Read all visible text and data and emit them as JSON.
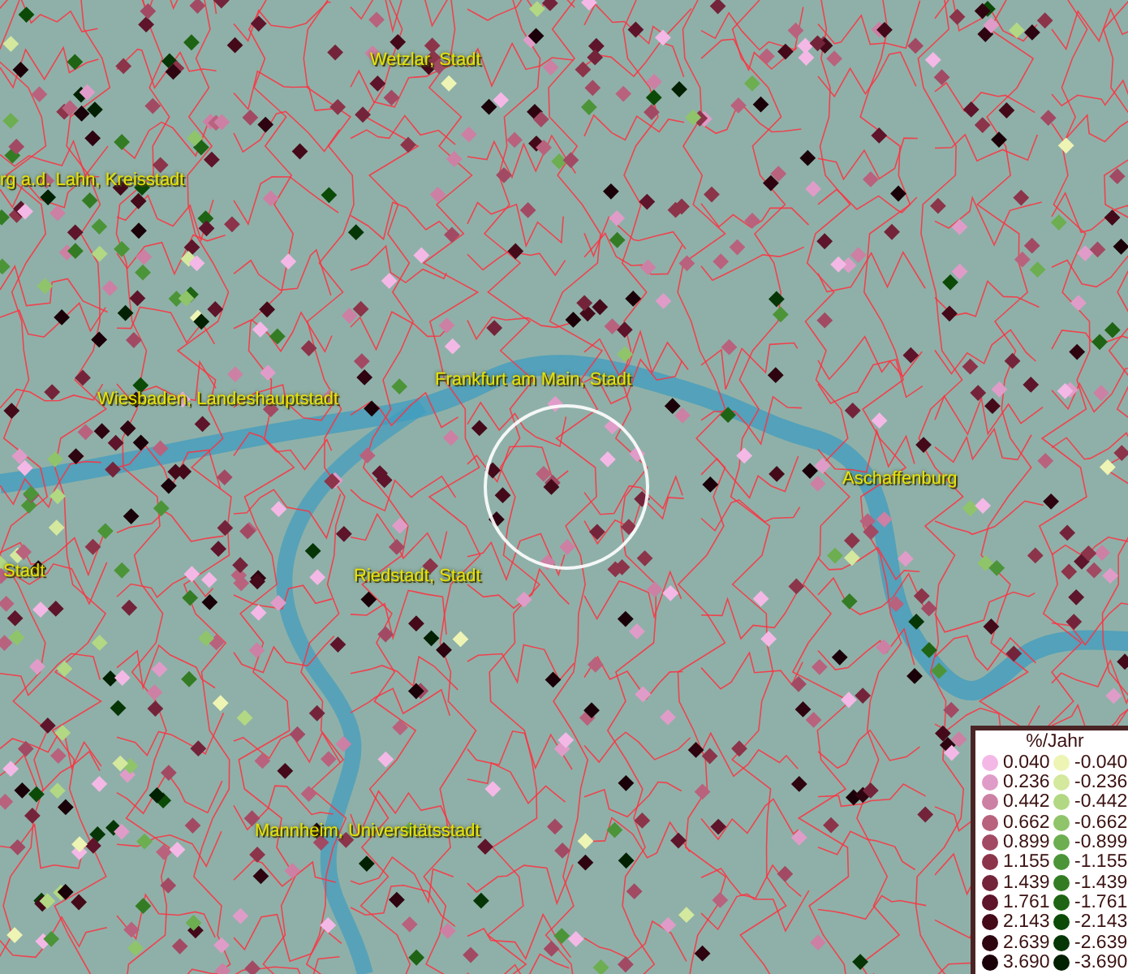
{
  "map": {
    "place_labels": [
      {
        "text": "Wetzlar, Stadt"
      },
      {
        "text": "rg a.d. Lahn, Kreisstadt"
      },
      {
        "text": "Wiesbaden, Landeshauptstadt"
      },
      {
        "text": "Frankfurt am Main, Stadt"
      },
      {
        "text": "Aschaffenburg"
      },
      {
        "text": "Stadt"
      },
      {
        "text": "Riedstadt, Stadt"
      },
      {
        "text": "Mannheim, Universitätsstadt"
      }
    ]
  },
  "legend": {
    "title": "%/Jahr",
    "rows": [
      {
        "positive": {
          "label": "0.040",
          "color": "#f4b8e6"
        },
        "negative": {
          "label": "-0.040",
          "color": "#eef4b4"
        }
      },
      {
        "positive": {
          "label": "0.236",
          "color": "#e09cc8"
        },
        "negative": {
          "label": "-0.236",
          "color": "#d4e89e"
        }
      },
      {
        "positive": {
          "label": "0.442",
          "color": "#cc80a4"
        },
        "negative": {
          "label": "-0.442",
          "color": "#b2d884"
        }
      },
      {
        "positive": {
          "label": "0.662",
          "color": "#b8627e"
        },
        "negative": {
          "label": "-0.662",
          "color": "#90c46a"
        }
      },
      {
        "positive": {
          "label": "0.899",
          "color": "#a24a64"
        },
        "negative": {
          "label": "-0.899",
          "color": "#6cae50"
        }
      },
      {
        "positive": {
          "label": "1.155",
          "color": "#8c344a"
        },
        "negative": {
          "label": "-1.155",
          "color": "#4c9438"
        }
      },
      {
        "positive": {
          "label": "1.439",
          "color": "#74243a"
        },
        "negative": {
          "label": "-1.439",
          "color": "#347c24"
        }
      },
      {
        "positive": {
          "label": "1.761",
          "color": "#5e142a"
        },
        "negative": {
          "label": "-1.761",
          "color": "#1e6414"
        }
      },
      {
        "positive": {
          "label": "2.143",
          "color": "#440a1a"
        },
        "negative": {
          "label": "-2.143",
          "color": "#0c4a08"
        }
      },
      {
        "positive": {
          "label": "2.639",
          "color": "#2e0410"
        },
        "negative": {
          "label": "-2.639",
          "color": "#063606"
        }
      },
      {
        "positive": {
          "label": "3.690",
          "color": "#1a0008"
        },
        "negative": {
          "label": "-3.690",
          "color": "#022002"
        }
      }
    ]
  }
}
